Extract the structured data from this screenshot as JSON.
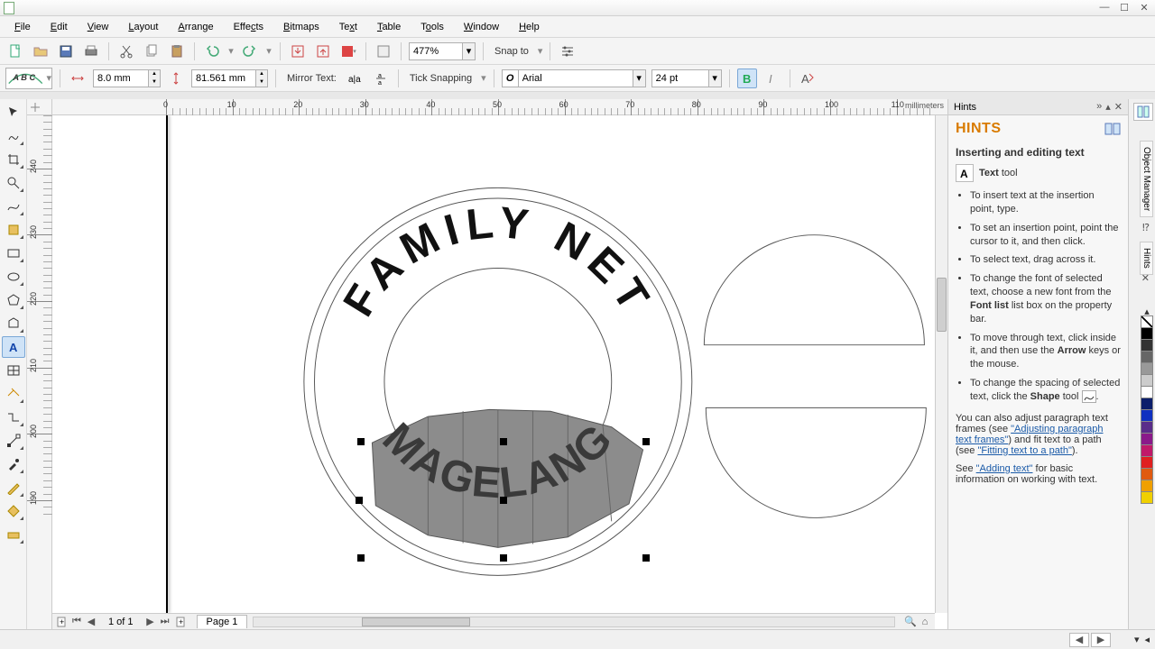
{
  "titlebar": {
    "title": ""
  },
  "menu": {
    "file": "File",
    "edit": "Edit",
    "view": "View",
    "layout": "Layout",
    "arrange": "Arrange",
    "effects": "Effects",
    "bitmaps": "Bitmaps",
    "text": "Text",
    "table": "Table",
    "tools": "Tools",
    "window": "Window",
    "help": "Help"
  },
  "toolbar1": {
    "zoom": "477%",
    "snap_label": "Snap to"
  },
  "toolbar2": {
    "preset": "ABC",
    "offset_x": "8.0 mm",
    "offset_y": "81.561 mm",
    "mirror_label": "Mirror Text:",
    "tick_label": "Tick Snapping",
    "font": "Arial",
    "font_size": "24 pt"
  },
  "ruler": {
    "unit": "millimeters",
    "h_ticks": [
      10,
      20,
      30,
      40,
      50,
      60,
      70,
      80,
      90,
      100,
      110
    ],
    "h_zero": 126,
    "h_scale": 7.36,
    "v_ticks": [
      190,
      200,
      210,
      220,
      230,
      240
    ],
    "v_top_value": 248,
    "v_scale": 7.36
  },
  "canvas": {
    "text_top": "FAMILY NET",
    "text_bottom": "MAGELANG"
  },
  "pager": {
    "count": "1 of 1",
    "tab": "Page 1"
  },
  "hints": {
    "title": "Hints",
    "heading": "HINTS",
    "subtitle": "Inserting and editing text",
    "tool_label": "Text",
    "tool_suffix": "tool",
    "bullets": [
      "To insert text at the insertion point, type.",
      "To set an insertion point, point the cursor to it, and then click.",
      "To select text, drag across it.",
      "To change the font of selected text, choose a new font from the Font list list box on the property bar.",
      "To move through text, click inside it, and then use the Arrow keys or the mouse.",
      "To change the spacing of selected text, click the Shape tool "
    ],
    "para1_a": "You can also adjust paragraph text frames (see ",
    "para1_link1": "\"Adjusting paragraph text frames\"",
    "para1_b": ") and fit text to a path (see ",
    "para1_link2": "\"Fitting text to a path\"",
    "para1_c": ").",
    "para2_a": "See ",
    "para2_link": "\"Adding text\"",
    "para2_b": " for basic information on working with text."
  },
  "right_dock": {
    "tab1": "Object Manager",
    "tab2": "Hints"
  },
  "palette": [
    "nocolor",
    "#000000",
    "#333333",
    "#666666",
    "#999999",
    "#cccccc",
    "#ffffff",
    "#0b1e6b",
    "#1030c0",
    "#5a2d8a",
    "#8a1a8a",
    "#c01a6a",
    "#e02020",
    "#e05a10",
    "#f0a000",
    "#f0d000"
  ]
}
